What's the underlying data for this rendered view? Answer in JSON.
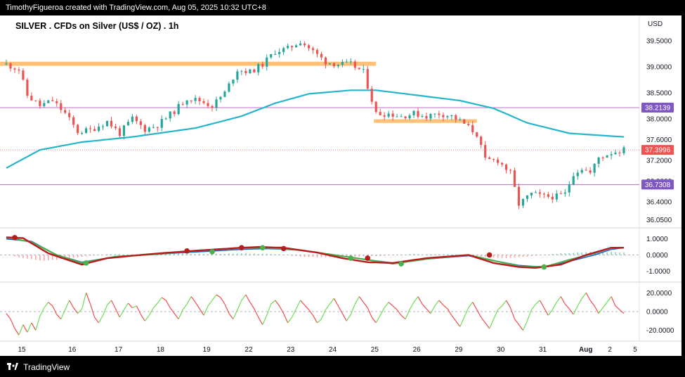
{
  "header": {
    "caption": "TimothyFigueroa created with TradingView.com, Aug 05, 2025 10:32 UTC+8"
  },
  "footer": {
    "brand": "TradingView"
  },
  "colors": {
    "bull": "#26a69a",
    "bear": "#ef5350",
    "ema": "#26b5c8",
    "zone": "#ffc078",
    "hline": "#c77dcf",
    "macd_fast": "#b71c1c",
    "macd_slow": "#1e63d6",
    "macd_signal": "#4caf50",
    "osc_up": "#6fdc53",
    "osc_down": "#f04d4d"
  },
  "chart_data": {
    "type": "candlestick",
    "title": "SILVER . CFDs on Silver (US$ / OZ) . 1h",
    "currency_label": "USD",
    "price_axis_ticks": [
      "39.5000",
      "39.0000",
      "38.5000",
      "38.0000",
      "37.6000",
      "37.2000",
      "36.8000",
      "36.4000",
      "36.0500"
    ],
    "price_range": [
      35.95,
      39.72
    ],
    "date_labels": [
      "15",
      "16",
      "17",
      "18",
      "19",
      "22",
      "23",
      "24",
      "25",
      "26",
      "29",
      "30",
      "31",
      "Aug",
      "2",
      "5"
    ],
    "price_badges": [
      {
        "value": "38.2139",
        "kind": "level"
      },
      {
        "value": "37.3996",
        "kind": "last"
      },
      {
        "value": "36.7308",
        "kind": "level"
      }
    ],
    "horizontal_levels": [
      38.2139,
      36.7308
    ],
    "last_price": 37.3996,
    "resistance_zones": [
      {
        "from_day": "15",
        "to_day": "25",
        "price_low": 39.02,
        "price_high": 39.1
      },
      {
        "from_day": "26",
        "to_day": "31",
        "price_low": 37.92,
        "price_high": 37.99
      }
    ],
    "price_anchors": [
      [
        0,
        39.05
      ],
      [
        3,
        38.95
      ],
      [
        5,
        38.45
      ],
      [
        8,
        38.25
      ],
      [
        11,
        38.35
      ],
      [
        14,
        38.1
      ],
      [
        17,
        37.75
      ],
      [
        20,
        37.78
      ],
      [
        24,
        37.95
      ],
      [
        27,
        37.72
      ],
      [
        30,
        38.0
      ],
      [
        33,
        37.8
      ],
      [
        36,
        37.88
      ],
      [
        40,
        38.15
      ],
      [
        43,
        38.4
      ],
      [
        46,
        38.35
      ],
      [
        49,
        38.25
      ],
      [
        52,
        38.5
      ],
      [
        55,
        38.95
      ],
      [
        58,
        38.9
      ],
      [
        61,
        39.05
      ],
      [
        64,
        39.3
      ],
      [
        67,
        39.35
      ],
      [
        70,
        39.5
      ],
      [
        73,
        39.3
      ],
      [
        76,
        39.1
      ],
      [
        79,
        39.05
      ],
      [
        82,
        39.05
      ],
      [
        85,
        38.9
      ],
      [
        88,
        38.1
      ],
      [
        91,
        38.1
      ],
      [
        94,
        38.05
      ],
      [
        97,
        38.1
      ],
      [
        100,
        38.05
      ],
      [
        103,
        38.1
      ],
      [
        106,
        38.05
      ],
      [
        109,
        37.9
      ],
      [
        112,
        37.7
      ],
      [
        114,
        37.2
      ],
      [
        117,
        37.2
      ],
      [
        120,
        36.95
      ],
      [
        122,
        36.35
      ],
      [
        125,
        36.55
      ],
      [
        128,
        36.5
      ],
      [
        131,
        36.5
      ],
      [
        133,
        36.55
      ],
      [
        135,
        36.95
      ],
      [
        137,
        37.05
      ],
      [
        139,
        36.95
      ],
      [
        141,
        37.25
      ],
      [
        144,
        37.35
      ],
      [
        147,
        37.4
      ]
    ],
    "ema_anchors": [
      [
        0,
        37.05
      ],
      [
        8,
        37.4
      ],
      [
        18,
        37.55
      ],
      [
        30,
        37.65
      ],
      [
        45,
        37.82
      ],
      [
        56,
        38.05
      ],
      [
        64,
        38.3
      ],
      [
        72,
        38.48
      ],
      [
        82,
        38.55
      ],
      [
        88,
        38.55
      ],
      [
        98,
        38.45
      ],
      [
        108,
        38.35
      ],
      [
        116,
        38.2
      ],
      [
        124,
        37.92
      ],
      [
        134,
        37.72
      ],
      [
        147,
        37.65
      ]
    ],
    "macd": {
      "range": [
        -1.6,
        1.6
      ],
      "axis_ticks": [
        "1.0000",
        "0.0000",
        "-1.0000"
      ],
      "fast_anchors": [
        [
          0,
          1.1
        ],
        [
          4,
          1.05
        ],
        [
          10,
          0.1
        ],
        [
          18,
          -0.6
        ],
        [
          24,
          -0.2
        ],
        [
          34,
          0.05
        ],
        [
          44,
          0.25
        ],
        [
          56,
          0.45
        ],
        [
          60,
          0.5
        ],
        [
          66,
          0.45
        ],
        [
          74,
          0.15
        ],
        [
          80,
          -0.2
        ],
        [
          86,
          -0.45
        ],
        [
          92,
          -0.5
        ],
        [
          100,
          -0.2
        ],
        [
          110,
          0.0
        ],
        [
          116,
          -0.5
        ],
        [
          122,
          -0.75
        ],
        [
          126,
          -0.8
        ],
        [
          132,
          -0.6
        ],
        [
          138,
          0.0
        ],
        [
          144,
          0.45
        ],
        [
          147,
          0.45
        ]
      ],
      "slow_anchors": [
        [
          0,
          1.0
        ],
        [
          6,
          0.85
        ],
        [
          12,
          0.0
        ],
        [
          18,
          -0.45
        ],
        [
          26,
          -0.1
        ],
        [
          36,
          0.05
        ],
        [
          46,
          0.2
        ],
        [
          56,
          0.35
        ],
        [
          62,
          0.4
        ],
        [
          70,
          0.3
        ],
        [
          78,
          0.0
        ],
        [
          86,
          -0.3
        ],
        [
          92,
          -0.5
        ],
        [
          100,
          -0.25
        ],
        [
          110,
          -0.05
        ],
        [
          116,
          -0.35
        ],
        [
          122,
          -0.65
        ],
        [
          128,
          -0.75
        ],
        [
          134,
          -0.4
        ],
        [
          140,
          0.0
        ],
        [
          144,
          0.35
        ],
        [
          147,
          0.45
        ]
      ],
      "signal_anchors": [
        [
          0,
          1.1
        ],
        [
          6,
          0.8
        ],
        [
          12,
          0.0
        ],
        [
          18,
          -0.5
        ],
        [
          26,
          -0.1
        ],
        [
          36,
          0.05
        ],
        [
          46,
          0.28
        ],
        [
          56,
          0.45
        ],
        [
          62,
          0.45
        ],
        [
          70,
          0.3
        ],
        [
          78,
          0.0
        ],
        [
          86,
          -0.3
        ],
        [
          92,
          -0.55
        ],
        [
          100,
          -0.25
        ],
        [
          110,
          0.0
        ],
        [
          116,
          -0.35
        ],
        [
          122,
          -0.7
        ],
        [
          128,
          -0.75
        ],
        [
          134,
          -0.3
        ],
        [
          140,
          0.1
        ],
        [
          144,
          0.45
        ],
        [
          147,
          0.45
        ]
      ],
      "markers": [
        [
          2,
          1.08,
          "red"
        ],
        [
          19,
          -0.5,
          "green"
        ],
        [
          43,
          0.25,
          "red"
        ],
        [
          49,
          0.2,
          "green"
        ],
        [
          56,
          0.45,
          "red"
        ],
        [
          61,
          0.45,
          "green"
        ],
        [
          66,
          0.4,
          "red"
        ],
        [
          82,
          -0.2,
          "green"
        ],
        [
          86,
          -0.2,
          "red"
        ],
        [
          94,
          -0.55,
          "green"
        ],
        [
          115,
          0.0,
          "red"
        ],
        [
          128,
          -0.75,
          "green"
        ]
      ],
      "histogram_anchors": [
        [
          0,
          0.0
        ],
        [
          4,
          -0.2
        ],
        [
          8,
          -0.35
        ],
        [
          12,
          -0.3
        ],
        [
          18,
          -0.1
        ],
        [
          24,
          0.05
        ],
        [
          32,
          0.05
        ],
        [
          40,
          0.1
        ],
        [
          48,
          0.05
        ],
        [
          56,
          0.1
        ],
        [
          64,
          0.05
        ],
        [
          70,
          -0.1
        ],
        [
          76,
          -0.15
        ],
        [
          84,
          -0.1
        ],
        [
          90,
          -0.05
        ],
        [
          96,
          0.05
        ],
        [
          104,
          0.05
        ],
        [
          112,
          -0.1
        ],
        [
          118,
          -0.2
        ],
        [
          124,
          -0.1
        ],
        [
          132,
          0.1
        ],
        [
          140,
          0.2
        ],
        [
          147,
          0.15
        ]
      ]
    },
    "oscillator": {
      "range": [
        -30,
        30
      ],
      "axis_ticks": [
        "20.0000",
        "0.0000",
        "-20.0000"
      ],
      "values": [
        -2,
        -8,
        -18,
        -25,
        -14,
        -22,
        -12,
        -20,
        -5,
        4,
        10,
        6,
        -3,
        -8,
        2,
        12,
        4,
        -2,
        3,
        20,
        8,
        -6,
        -12,
        -4,
        7,
        12,
        3,
        -6,
        2,
        9,
        4,
        6,
        -3,
        -10,
        -4,
        4,
        9,
        15,
        12,
        4,
        -2,
        -8,
        2,
        8,
        16,
        10,
        3,
        -4,
        6,
        12,
        18,
        15,
        8,
        -2,
        -8,
        2,
        12,
        18,
        10,
        3,
        -6,
        -14,
        -4,
        8,
        12,
        6,
        -2,
        -12,
        -6,
        3,
        12,
        7,
        2,
        -4,
        -12,
        -8,
        2,
        8,
        14,
        6,
        -2,
        -10,
        -3,
        8,
        16,
        10,
        4,
        -6,
        -12,
        -4,
        4,
        10,
        6,
        2,
        -4,
        -8,
        2,
        10,
        16,
        8,
        3,
        -2,
        6,
        12,
        7,
        3,
        -4,
        -10,
        -16,
        -6,
        4,
        10,
        2,
        -6,
        -12,
        -18,
        -8,
        2,
        6,
        12,
        4,
        -8,
        -14,
        -20,
        -10,
        2,
        8,
        12,
        4,
        -4,
        2,
        10,
        16,
        8,
        3,
        -3,
        6,
        14,
        20,
        12,
        6,
        -2,
        4,
        10,
        16,
        6,
        2,
        -2
      ]
    }
  }
}
